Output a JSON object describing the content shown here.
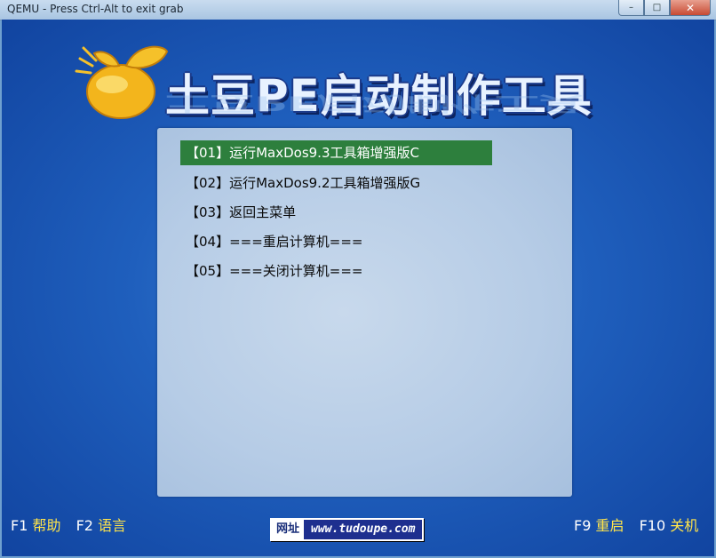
{
  "window": {
    "title": "QEMU - Press Ctrl-Alt to exit grab",
    "minimize_label": "–",
    "maximize_label": "□",
    "close_label": "✕"
  },
  "logo": {
    "title": "土豆PE启动制作工具"
  },
  "menu": {
    "items": [
      {
        "label": "【01】运行MaxDos9.3工具箱增强版C",
        "selected": true
      },
      {
        "label": "【02】运行MaxDos9.2工具箱增强版G",
        "selected": false
      },
      {
        "label": "【03】返回主菜单",
        "selected": false
      },
      {
        "label": "【04】===重启计算机===",
        "selected": false
      },
      {
        "label": "【05】===关闭计算机===",
        "selected": false
      }
    ]
  },
  "footer": {
    "left": [
      {
        "key": "F1",
        "label": "帮助"
      },
      {
        "key": "F2",
        "label": "语言"
      }
    ],
    "right": [
      {
        "key": "F9",
        "label": "重启"
      },
      {
        "key": "F10",
        "label": "关机"
      }
    ],
    "url_label": "网址",
    "url": "www.tudoupe.com"
  },
  "colors": {
    "selected_bg": "#2d7f3d",
    "fkey_label": "#ffe44a",
    "screen_bg": "#1f5fbd"
  }
}
